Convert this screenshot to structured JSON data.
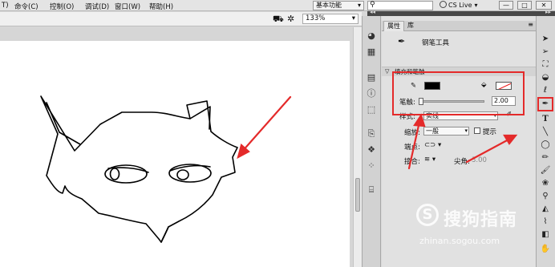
{
  "menu": [
    "T)",
    "命令(C)",
    "控制(O)",
    "调试(D)",
    "窗口(W)",
    "帮助(H)"
  ],
  "workspace": "基本功能",
  "cs_live": "CS Live",
  "window_buttons": [
    "—",
    "□",
    "✕"
  ],
  "zoom": "133%",
  "panel": {
    "tabs": [
      "属性",
      "库"
    ],
    "tool_name": "钢笔工具",
    "section": "填充和笔触",
    "stroke_label": "笔触:",
    "stroke_value": "2.00",
    "style_label": "样式:",
    "style_value": "实线",
    "scale_label": "缩放:",
    "scale_value": "一般",
    "hint_label": "提示",
    "cap_label": "端点:",
    "join_label": "接合:",
    "miter_label": "尖角:",
    "miter_value": "3.00"
  },
  "watermark": {
    "logo_char": "S",
    "name": "搜狗指南",
    "url": "zhinan.sogou.com"
  },
  "colors": {
    "stroke": "#000000",
    "fill": "#ffffff",
    "highlight": "#e42a2a"
  }
}
